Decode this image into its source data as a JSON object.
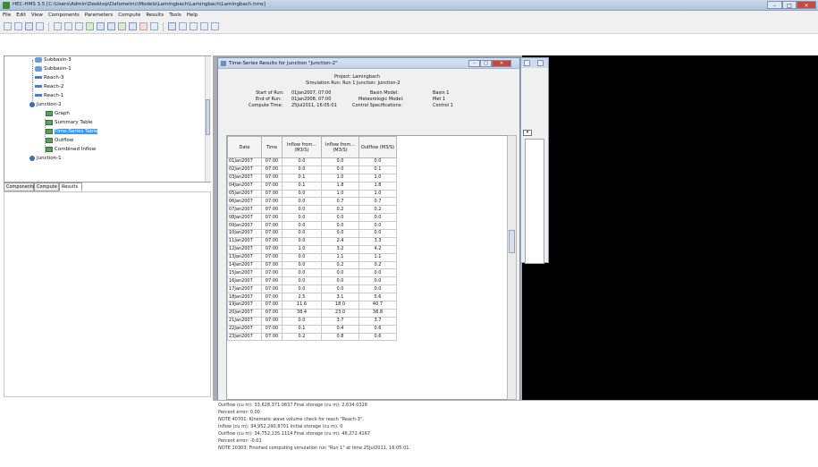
{
  "app": {
    "title": "HEC-HMS 3.5 [C:\\Users\\Admin\\Desktop\\Dafometric\\Models\\Lamingbach\\Lamingbach\\Lamingbach.hms]",
    "window_controls": {
      "minimize": "–",
      "maximize": "□",
      "close": "✕"
    }
  },
  "menu": [
    "File",
    "Edit",
    "View",
    "Components",
    "Parameters",
    "Compute",
    "Results",
    "Tools",
    "Help"
  ],
  "toolbar_icons": [
    "new-icon",
    "open-icon",
    "save-icon",
    "print-icon",
    "select-icon",
    "pan-icon",
    "zoom-icon",
    "subbasin-icon",
    "reach-icon",
    "reservoir-icon",
    "source-icon",
    "junction-icon",
    "diversion-icon",
    "sink-icon",
    "compute-icon",
    "graph-icon",
    "summary-icon",
    "table-icon",
    "results-icon"
  ],
  "explorer": {
    "items": [
      "Subbasin-3",
      "Subbasin-1",
      "Reach-3",
      "Reach-2",
      "Reach-1",
      "Junction-2",
      "Graph",
      "Summary Table",
      "Time-Series Table",
      "Outflow",
      "Combined Inflow",
      "Junction-1"
    ],
    "selected": "Time-Series Table",
    "tabs": [
      "Components",
      "Compute",
      "Results"
    ],
    "active_tab": "Results"
  },
  "ts_window": {
    "title": "Time-Series Results for Junction \"Junction-2\"",
    "project": "Project: Lamingbach",
    "run_line": "Simulation Run: Run 1     Junction: Junction-2",
    "start_label": "Start of Run:",
    "start_value": "01Jan2007, 07:00",
    "end_label": "End of Run:",
    "end_value": "01Jan2008, 07:00",
    "compute_label": "Compute Time:",
    "compute_value": "25Jul2011, 16:05:01",
    "basin_label": "Basin Model:",
    "basin_value": "Basin 1",
    "met_label": "Meteorologic Model:",
    "met_value": "Met 1",
    "control_label": "Control Specifications:",
    "control_value": "Control 1",
    "columns": [
      "Date",
      "Time",
      "Inflow from... (M3/S)",
      "Inflow from... (M3/S)",
      "Outflow (M3/S)"
    ],
    "rows": [
      [
        "01Jan2007",
        "07:00",
        "0.0",
        "0.0",
        "0.0"
      ],
      [
        "02Jan2007",
        "07:00",
        "0.0",
        "0.0",
        "0.1"
      ],
      [
        "03Jan2007",
        "07:00",
        "0.1",
        "1.0",
        "1.0"
      ],
      [
        "04Jan2007",
        "07:00",
        "0.1",
        "1.8",
        "1.8"
      ],
      [
        "05Jan2007",
        "07:00",
        "0.0",
        "1.0",
        "1.0"
      ],
      [
        "06Jan2007",
        "07:00",
        "0.0",
        "0.7",
        "0.7"
      ],
      [
        "07Jan2007",
        "07:00",
        "0.0",
        "0.2",
        "0.2"
      ],
      [
        "08Jan2007",
        "07:00",
        "0.0",
        "0.0",
        "0.0"
      ],
      [
        "09Jan2007",
        "07:00",
        "0.0",
        "0.0",
        "0.0"
      ],
      [
        "10Jan2007",
        "07:00",
        "0.0",
        "0.0",
        "0.0"
      ],
      [
        "11Jan2007",
        "07:00",
        "0.0",
        "2.4",
        "3.3"
      ],
      [
        "12Jan2007",
        "07:00",
        "1.0",
        "3.2",
        "4.2"
      ],
      [
        "13Jan2007",
        "07:00",
        "0.0",
        "1.1",
        "1.1"
      ],
      [
        "14Jan2007",
        "07:00",
        "0.0",
        "0.2",
        "0.2"
      ],
      [
        "15Jan2007",
        "07:00",
        "0.0",
        "0.0",
        "0.0"
      ],
      [
        "16Jan2007",
        "07:00",
        "0.0",
        "0.0",
        "0.0"
      ],
      [
        "17Jan2007",
        "07:00",
        "0.0",
        "0.0",
        "0.0"
      ],
      [
        "18Jan2007",
        "07:00",
        "2.5",
        "3.1",
        "5.6"
      ],
      [
        "19Jan2007",
        "07:00",
        "11.6",
        "18.0",
        "40.7"
      ],
      [
        "20Jan2007",
        "07:00",
        "38.4",
        "23.0",
        "38.8"
      ],
      [
        "21Jan2007",
        "07:00",
        "0.0",
        "3.7",
        "3.7"
      ],
      [
        "22Jan2007",
        "07:00",
        "0.1",
        "0.4",
        "0.6"
      ],
      [
        "23Jan2007",
        "07:00",
        "0.2",
        "0.8",
        "0.6"
      ]
    ]
  },
  "messages": [
    "Outflow (cu m): 33,628,371.0837  Final storage (cu m): 2,634.0328",
    "Percent error: 0.00",
    "NOTE 40701: Kinematic wave volume check for reach \"Reach-3\".",
    "Inflow (cu m): 34,952,290.8701  Initial storage (cu m): 0",
    "Outflow (cu m): 34,752,135.1114  Final storage (cu m): 46,272.4167",
    "Percent error: -0.01",
    "NOTE 10303: Finished computing simulation run \"Run 1\" at time 25Jul2011, 16:05:01."
  ]
}
